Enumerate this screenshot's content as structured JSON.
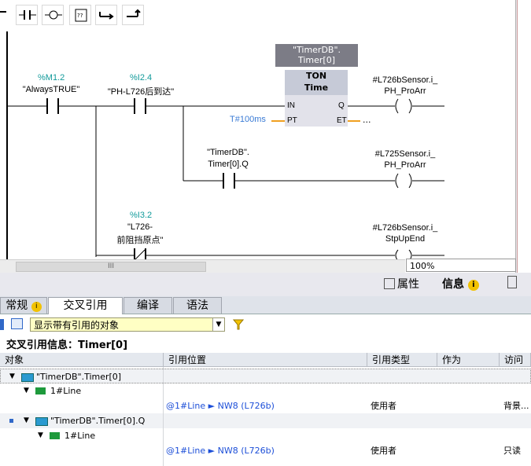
{
  "toolbar": {
    "items": [
      {
        "name": "contact-open-icon"
      },
      {
        "name": "contact-closed-icon"
      },
      {
        "name": "coil-icon"
      },
      {
        "name": "empty-box-icon",
        "label": "??"
      },
      {
        "name": "open-branch-icon"
      },
      {
        "name": "close-branch-icon"
      }
    ]
  },
  "ladder": {
    "db_label_line1": "\"TimerDB\".",
    "db_label_line2": "Timer[0]",
    "ton_title": "TON",
    "ton_subtitle": "Time",
    "pin_in": "IN",
    "pin_q": "Q",
    "pin_pt": "PT",
    "pin_et": "ET",
    "pt_value": "T#100ms",
    "et_value": "...",
    "contacts": [
      {
        "addr": "%M1.2",
        "sym": "\"AlwaysTRUE\""
      },
      {
        "addr": "%I2.4",
        "sym": "\"PH-L726后到达\""
      },
      {
        "addr": "",
        "sym_line1": "\"TimerDB\".",
        "sym_line2": "Timer[0].Q"
      },
      {
        "addr": "%I3.2",
        "sym_line1": "\"L726-",
        "sym_line2": "前阻挡原点\""
      }
    ],
    "coils": [
      {
        "line1": "#L726bSensor.i_",
        "line2": "PH_ProArr"
      },
      {
        "line1": "#L725Sensor.i_",
        "line2": "PH_ProArr"
      },
      {
        "line1": "#L726bSensor.i_",
        "line2": "StpUpEnd"
      }
    ]
  },
  "scroll": {
    "thumb_label": "III"
  },
  "zoom": {
    "value": "100%"
  },
  "inspector_tabs": {
    "properties": "属性",
    "info": "信息",
    "info_icon": "i",
    "diagnostics_icon": "stethoscope-icon"
  },
  "tabs": [
    {
      "label": "常规",
      "icon": "info-icon"
    },
    {
      "label": "交叉引用",
      "active": true
    },
    {
      "label": "编译"
    },
    {
      "label": "语法"
    }
  ],
  "filter": {
    "value": "显示带有引用的对象"
  },
  "title": "交叉引用信息：Timer[0]",
  "grid": {
    "headers": [
      "对象",
      "引用位置",
      "引用类型",
      "作为",
      "访问"
    ],
    "rows": [
      {
        "kind": "object",
        "text": "\"TimerDB\".Timer[0]",
        "indent": 1
      },
      {
        "kind": "block",
        "text": "1#Line",
        "indent": 2
      },
      {
        "kind": "ref",
        "location": "@1#Line ► NW8 (L726b)",
        "type": "使用者",
        "as": "",
        "access": "背景..."
      },
      {
        "kind": "object",
        "text": "\"TimerDB\".Timer[0].Q",
        "indent": 1
      },
      {
        "kind": "block",
        "text": "1#Line",
        "indent": 2
      },
      {
        "kind": "ref",
        "location": "@1#Line ► NW8 (L726b)",
        "type": "使用者",
        "as": "",
        "access": "只读"
      }
    ]
  },
  "colors": {
    "address": "#119a9a",
    "pt_value": "#3a7bd5",
    "et_dash": "#f0a020",
    "link": "#1d4fd8",
    "filter_bg": "#ffffc4"
  }
}
